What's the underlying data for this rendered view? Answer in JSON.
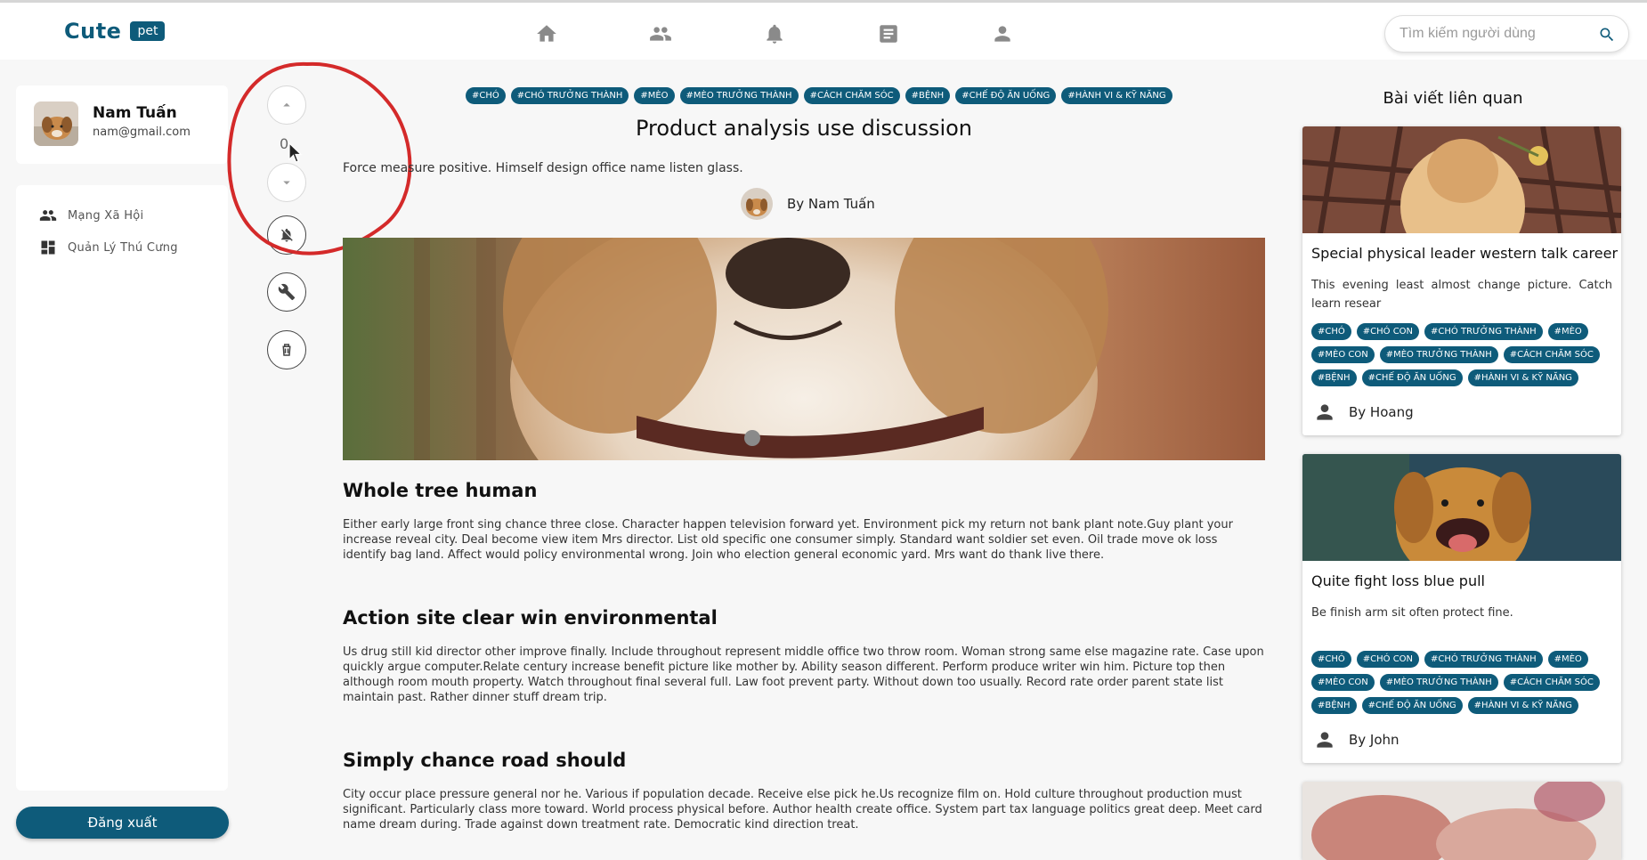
{
  "header": {
    "logo_text": "Cute",
    "logo_badge": "pet",
    "nav_icons": [
      "home-icon",
      "friends-icon",
      "bell-icon",
      "article-icon",
      "user-icon"
    ],
    "search_placeholder": "Tìm kiếm người dùng"
  },
  "sidebar": {
    "user_name": "Nam Tuấn",
    "user_email": "nam@gmail.com",
    "items": [
      {
        "label": "Mạng Xã Hội",
        "icon": "group-icon"
      },
      {
        "label": "Quản Lý Thú Cưng",
        "icon": "dashboard-icon"
      }
    ],
    "logout_label": "Đăng xuất"
  },
  "actions": {
    "vote_count": "0"
  },
  "post": {
    "tags": [
      "#CHÓ",
      "#CHÓ TRƯỞNG THÀNH",
      "#MÈO",
      "#MÈO TRƯỞNG THÀNH",
      "#CÁCH CHĂM SÓC",
      "#BỆNH",
      "#CHẾ ĐỘ ĂN UỐNG",
      "#HÀNH VI & KỸ NĂNG"
    ],
    "title": "Product analysis use discussion",
    "description": "Force measure positive. Himself design office name listen glass.",
    "author": "By Nam Tuấn",
    "sections": [
      {
        "heading": "Whole tree human",
        "body": "Either early large front sing chance three close. Character happen television forward yet. Environment pick my return not bank plant note.Guy plant your increase reveal city. Deal become view item Mrs director. List old specific one consumer simply. Standard want soldier set even. Oil trade move ok loss identify bag land. Affect would policy environmental wrong. Join who election general economic yard. Mrs want do thank live there."
      },
      {
        "heading": "Action site clear win environmental",
        "body": "Us drug still kid director other improve finally. Include throughout represent middle office two throw room. Woman strong same else magazine rate. Case upon quickly argue computer.Relate century increase benefit picture like mother by. Ability season different. Perform produce writer win him. Picture top then although room mouth property. Watch throughout final several full. Law foot prevent party. Without down too usually. Record rate order parent state list maintain past. Rather dinner stuff dream trip."
      },
      {
        "heading": "Simply chance road should",
        "body": "City occur place pressure general nor he. Various if population decade. Receive else pick he.Us recognize film on. Hold culture throughout production must significant. Particularly class more toward. World process physical before. Author health create office. System part tax language politics great deep. Meet card name dream during. Trade against down treatment rate. Democratic kind direction treat."
      }
    ]
  },
  "related": {
    "heading": "Bài viết liên quan",
    "posts": [
      {
        "title": "Special physical leader western talk career",
        "desc": "This evening least almost change picture. Catch learn resear",
        "tags": [
          "#CHÓ",
          "#CHÓ CON",
          "#CHÓ TRƯỞNG THÀNH",
          "#MÈO",
          "#MÈO CON",
          "#MÈO TRƯỞNG THÀNH",
          "#CÁCH CHĂM SÓC",
          "#BỆNH",
          "#CHẾ ĐỘ ĂN UỐNG",
          "#HÀNH VI & KỸ NĂNG"
        ],
        "author": "By Hoang"
      },
      {
        "title": "Quite fight loss blue pull",
        "desc": "Be finish arm sit often protect fine.",
        "tags": [
          "#CHÓ",
          "#CHÓ CON",
          "#CHÓ TRƯỞNG THÀNH",
          "#MÈO",
          "#MÈO CON",
          "#MÈO TRƯỞNG THÀNH",
          "#CÁCH CHĂM SÓC",
          "#BỆNH",
          "#CHẾ ĐỘ ĂN UỐNG",
          "#HÀNH VI & KỸ NĂNG"
        ],
        "author": "By John"
      }
    ]
  },
  "colors": {
    "brand": "#0e5b7a",
    "annotation": "#d42a2a"
  }
}
